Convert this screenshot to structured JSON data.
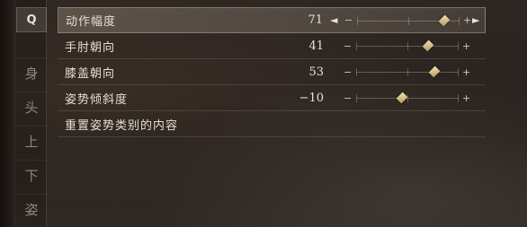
{
  "search": {
    "key": "Q"
  },
  "tabs": [
    {
      "label": "身"
    },
    {
      "label": "头"
    },
    {
      "label": "上"
    },
    {
      "label": "下"
    },
    {
      "label": "姿"
    }
  ],
  "settings": [
    {
      "label": "动作幅度",
      "value": "71",
      "level": 0.855,
      "selected": true
    },
    {
      "label": "手肘朝向",
      "value": "41",
      "level": 0.7,
      "selected": false
    },
    {
      "label": "膝盖朝向",
      "value": "53",
      "level": 0.765,
      "selected": false
    },
    {
      "label": "姿势倾斜度",
      "value": "−10",
      "level": 0.45,
      "selected": false
    }
  ],
  "reset": {
    "label": "重置姿势类别的内容"
  },
  "slider_controls": {
    "minus": "−",
    "plus": "+",
    "arrow_left": "◄",
    "arrow_right": "►"
  }
}
